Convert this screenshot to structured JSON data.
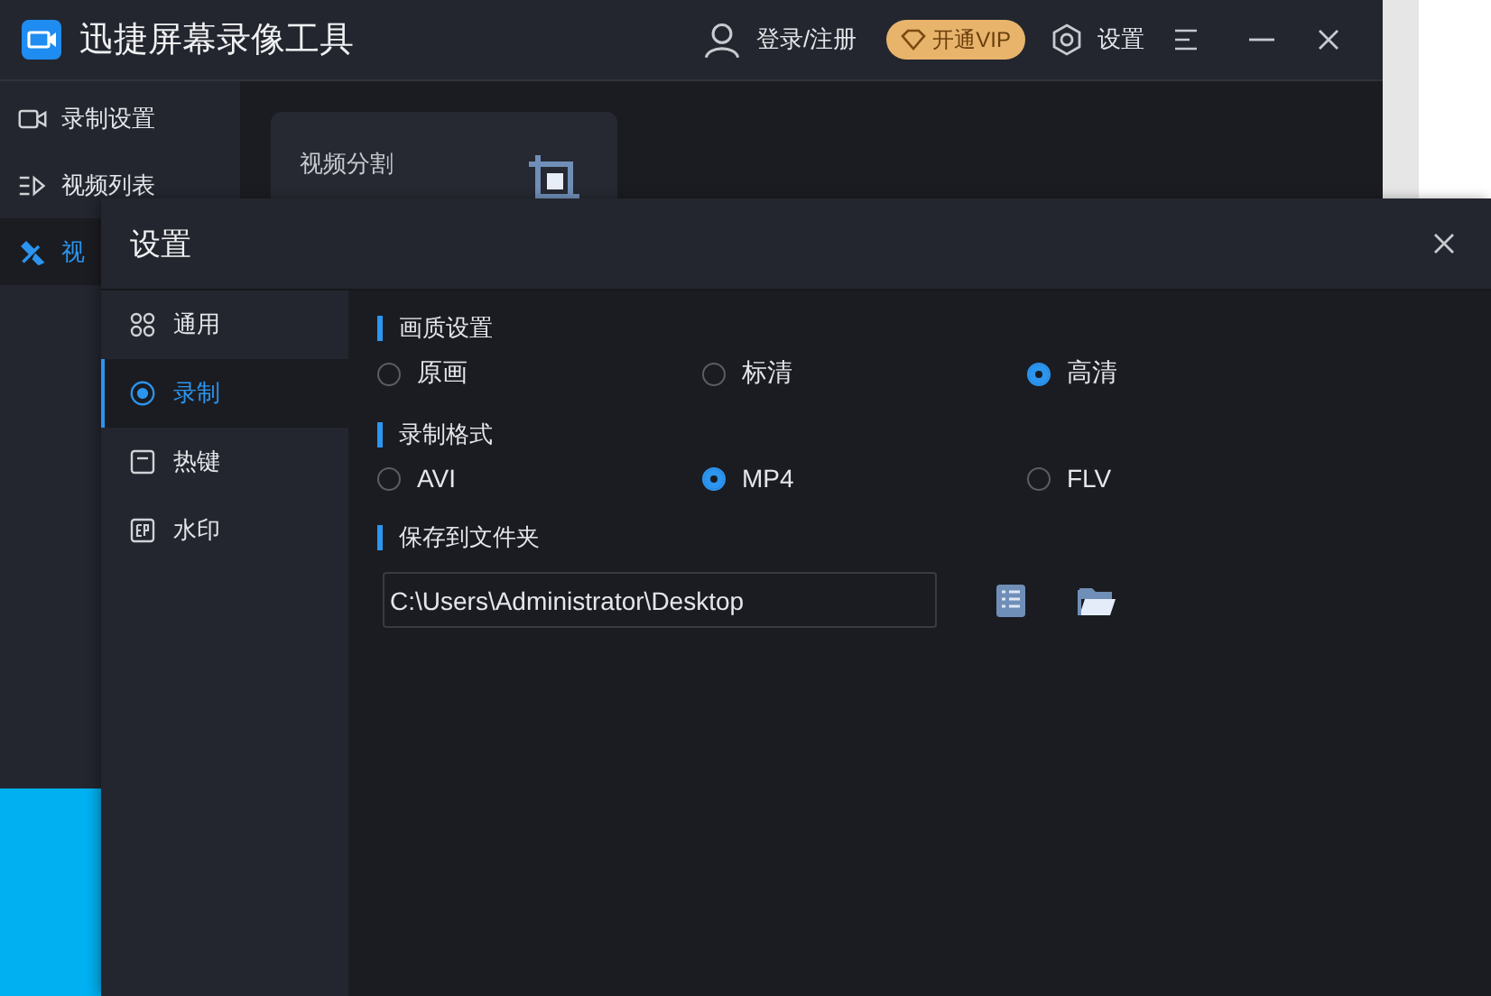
{
  "app": {
    "title": "迅捷屏幕录像工具",
    "account": "登录/注册",
    "vip_button": "开通VIP",
    "settings": "设置"
  },
  "sidebar": {
    "items": [
      {
        "label": "录制设置",
        "selected": false
      },
      {
        "label": "视频列表",
        "selected": false
      },
      {
        "label": "视",
        "selected": true
      }
    ]
  },
  "card": {
    "title": "视频分割"
  },
  "dialog": {
    "title": "设置",
    "nav": [
      {
        "label": "通用",
        "selected": false
      },
      {
        "label": "录制",
        "selected": true
      },
      {
        "label": "热键",
        "selected": false
      },
      {
        "label": "水印",
        "selected": false
      }
    ],
    "sections": [
      {
        "title": "画质设置",
        "kind": "radio",
        "options": [
          {
            "label": "原画",
            "selected": false
          },
          {
            "label": "标清",
            "selected": false
          },
          {
            "label": "高清",
            "selected": true
          }
        ]
      },
      {
        "title": "录制格式",
        "kind": "radio",
        "options": [
          {
            "label": "AVI",
            "selected": false
          },
          {
            "label": "MP4",
            "selected": true
          },
          {
            "label": "FLV",
            "selected": false
          }
        ]
      },
      {
        "title": "保存到文件夹",
        "kind": "folder",
        "value": "C:\\Users\\Administrator\\Desktop"
      }
    ]
  }
}
